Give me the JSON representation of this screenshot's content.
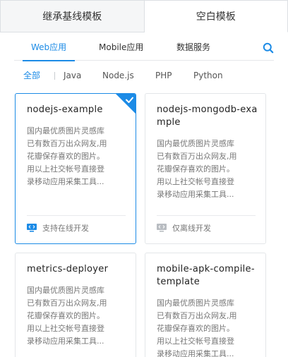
{
  "top_tabs": [
    {
      "label": "继承基线模板"
    },
    {
      "label": "空白模板"
    }
  ],
  "sub_tabs": [
    {
      "label": "Web应用"
    },
    {
      "label": "Mobile应用"
    },
    {
      "label": "数据服务"
    }
  ],
  "search": {
    "icon": "search-icon"
  },
  "filters": [
    {
      "label": "全部"
    },
    {
      "label": "Java"
    },
    {
      "label": "Node.js"
    },
    {
      "label": "PHP"
    },
    {
      "label": "Python"
    }
  ],
  "cards": [
    {
      "title": "nodejs-example",
      "desc_lines": [
        "国内最优质图片灵感库",
        "已有数百万出众网友,用",
        "花瓣保存喜欢的图片。",
        "用以上社交帐号直接登",
        "录移动应用采集工具..."
      ],
      "footer": "支持在线开发",
      "footer_icon": "monitor-code-icon",
      "selected": true
    },
    {
      "title": "nodejs-mongodb-example",
      "desc_lines": [
        "国内最优质图片灵感库",
        "已有数百万出众网友,用",
        "花瓣保存喜欢的图片。",
        "用以上社交帐号直接登",
        "录移动应用采集工具..."
      ],
      "footer": "仅离线开发",
      "footer_icon": "monitor-code-icon",
      "selected": false
    },
    {
      "title": "metrics-deployer",
      "desc_lines": [
        "国内最优质图片灵感库",
        "已有数百万出众网友,用",
        "花瓣保存喜欢的图片。",
        "用以上社交帐号直接登",
        "录移动应用采集工具..."
      ],
      "selected": false
    },
    {
      "title": "mobile-apk-compile-template",
      "desc_lines": [
        "国内最优质图片灵感库",
        "已有数百万出众网友,用",
        "花瓣保存喜欢的图片。",
        "用以上社交帐号直接登",
        "录移动应用采集工具..."
      ],
      "selected": false
    }
  ],
  "colors": {
    "accent": "#1c8be6",
    "muted_icon": "#b9bdc2"
  }
}
